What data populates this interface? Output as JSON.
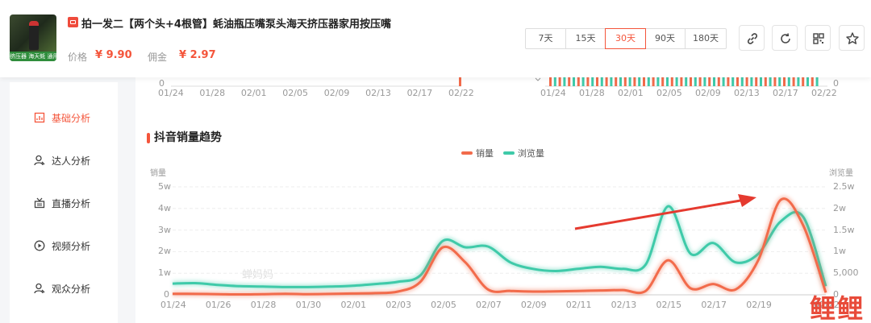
{
  "product": {
    "title": "拍一发二【两个头+4根管】蚝油瓶压嘴泵头海天挤压器家用按压嘴",
    "thumb_strip": "挤压器 海天蚝 通用",
    "price_label": "价格",
    "price": "¥ 9.90",
    "commission_label": "佣金",
    "commission": "¥ 2.97"
  },
  "date_ranges": [
    {
      "label": "7天",
      "active": false
    },
    {
      "label": "15天",
      "active": false
    },
    {
      "label": "30天",
      "active": true
    },
    {
      "label": "90天",
      "active": false
    },
    {
      "label": "180天",
      "active": false
    }
  ],
  "toolbar_icons": [
    "link-icon",
    "refresh-icon",
    "qrcode-icon",
    "star-icon"
  ],
  "upper_charts": {
    "left_zero": "0",
    "right_zero": "0",
    "left_ticks": [
      "01/24",
      "01/28",
      "02/01",
      "02/05",
      "02/09",
      "02/13",
      "02/17",
      "02/22"
    ],
    "right_ticks": [
      "01/24",
      "01/28",
      "02/01",
      "02/05",
      "02/09",
      "02/13",
      "02/17",
      "02/22"
    ]
  },
  "sidebar": {
    "items": [
      {
        "label": "基础分析",
        "icon": "chart-icon",
        "active": true
      },
      {
        "label": "达人分析",
        "icon": "user-icon",
        "active": false
      },
      {
        "label": "直播分析",
        "icon": "live-icon",
        "active": false
      },
      {
        "label": "视频分析",
        "icon": "play-icon",
        "active": false
      },
      {
        "label": "观众分析",
        "icon": "audience-icon",
        "active": false
      }
    ]
  },
  "section_title": "抖音销量趋势",
  "watermark": "蝉妈妈",
  "brand_logo": "鲤鲤",
  "chart_data": {
    "type": "line",
    "x": [
      "01/24",
      "01/25",
      "01/26",
      "01/27",
      "01/28",
      "01/29",
      "01/30",
      "01/31",
      "02/01",
      "02/02",
      "02/03",
      "02/04",
      "02/05",
      "02/06",
      "02/07",
      "02/08",
      "02/09",
      "02/10",
      "02/11",
      "02/12",
      "02/13",
      "02/14",
      "02/15",
      "02/16",
      "02/17",
      "02/18",
      "02/19",
      "02/20",
      "02/21",
      "02/22"
    ],
    "x_tick_labels": [
      "01/24",
      "01/26",
      "01/28",
      "01/30",
      "02/01",
      "02/03",
      "02/05",
      "02/07",
      "02/09",
      "02/11",
      "02/13",
      "02/15",
      "02/17",
      "02/19",
      "02/22"
    ],
    "ylabel": "销量",
    "y2label": "浏览量",
    "yticks": [
      "5w",
      "4w",
      "3w",
      "2w",
      "1w",
      "0"
    ],
    "y2ticks": [
      "2.5w",
      "2w",
      "1.5w",
      "1w",
      "5,000",
      "0"
    ],
    "ylim": [
      0,
      50000
    ],
    "y2lim": [
      0,
      25000
    ],
    "series": [
      {
        "name": "销量",
        "axis": "left",
        "color": "#f26b4b",
        "values": [
          500,
          400,
          300,
          200,
          300,
          500,
          300,
          400,
          600,
          800,
          1500,
          6000,
          22000,
          15000,
          2500,
          1800,
          1500,
          1600,
          1800,
          2000,
          2200,
          1800,
          16000,
          3000,
          5000,
          2500,
          16000,
          44000,
          32000,
          1000
        ]
      },
      {
        "name": "浏览量",
        "axis": "right",
        "color": "#3fcaa9",
        "values": [
          2600,
          2700,
          2300,
          2000,
          1900,
          1800,
          1800,
          1900,
          2100,
          2500,
          3000,
          4500,
          12500,
          11000,
          11200,
          7500,
          6000,
          5500,
          6000,
          6500,
          6000,
          7000,
          20500,
          9500,
          12000,
          7500,
          9500,
          17000,
          18000,
          2000
        ]
      }
    ],
    "annotation": "red arrow pointing up-right to the 02/20 sales peak",
    "legend_position": "top-center",
    "grid": true
  }
}
